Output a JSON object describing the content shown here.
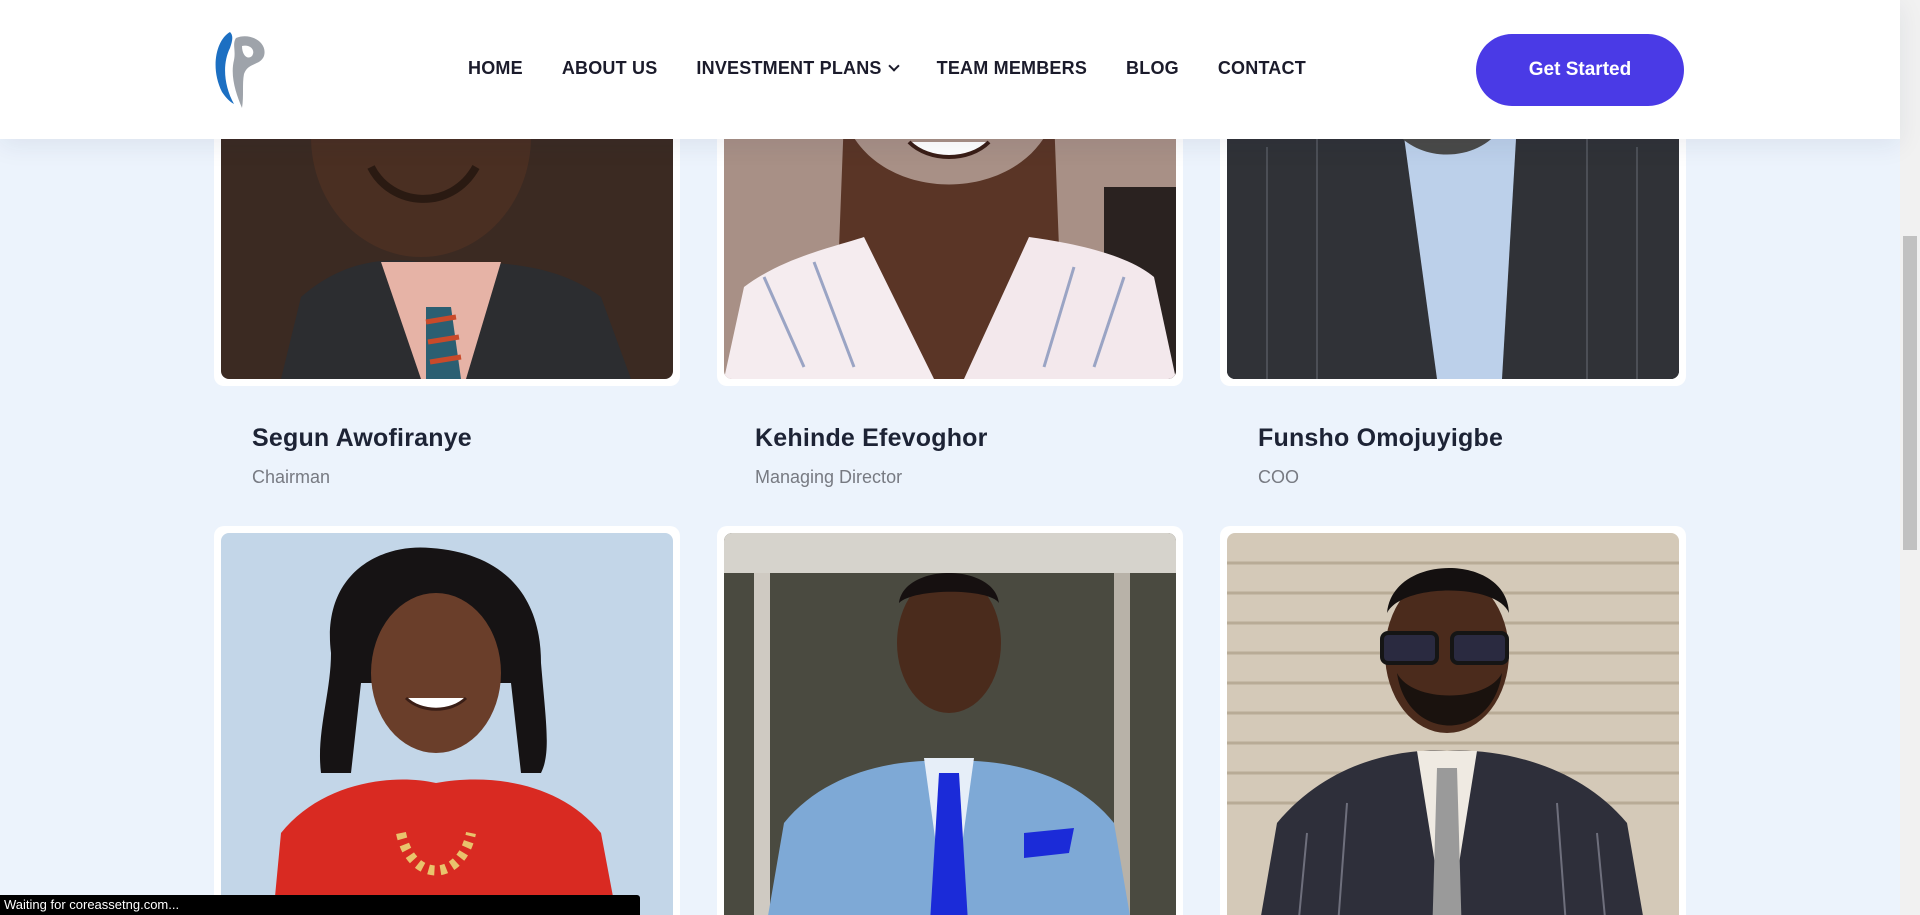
{
  "nav": {
    "items": [
      "HOME",
      "ABOUT US",
      "INVESTMENT PLANS",
      "TEAM MEMBERS",
      "BLOG",
      "CONTACT"
    ],
    "cta_label": "Get Started"
  },
  "team": [
    {
      "name": "Segun Awofiranye",
      "role": "Chairman"
    },
    {
      "name": "Kehinde Efevoghor",
      "role": "Managing Director"
    },
    {
      "name": "Funsho Omojuyigbe",
      "role": "COO"
    }
  ],
  "status_bar": {
    "text": "Waiting for coreassetng.com..."
  },
  "colors": {
    "accent": "#4a3ae6",
    "background": "#ecf3fc"
  }
}
